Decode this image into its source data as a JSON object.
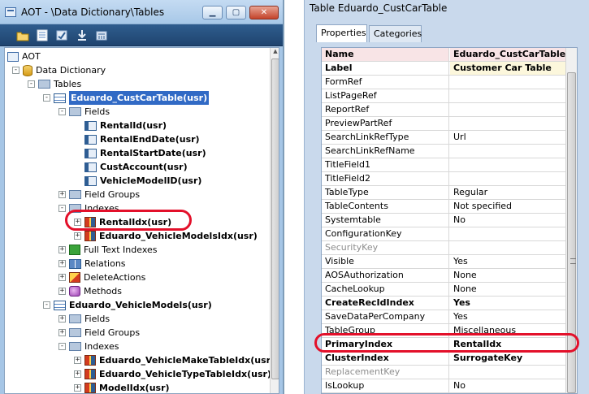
{
  "aot_window": {
    "title": "AOT - \\Data Dictionary\\Tables",
    "controls": {
      "minimize": "▁",
      "maximize": "▢",
      "close": "✕"
    },
    "toolbar": [
      "open-folder-icon",
      "properties-icon",
      "compile-icon",
      "import-icon",
      "calculator-icon"
    ],
    "tree": [
      {
        "label": "AOT",
        "icon": "aot-icon",
        "expander": "-"
      },
      {
        "label": "Data Dictionary",
        "icon": "database-icon",
        "expander": "-"
      },
      {
        "label": "Tables",
        "icon": "folder-icon",
        "expander": "-"
      },
      {
        "label": "Eduardo_CustCarTable(usr)",
        "icon": "table-icon",
        "expander": "-",
        "bold": true,
        "selected": true
      },
      {
        "label": "Fields",
        "icon": "folder-icon",
        "expander": "-"
      },
      {
        "label": "RentalId(usr)",
        "icon": "field-icon",
        "bold": true
      },
      {
        "label": "RentalEndDate(usr)",
        "icon": "field-icon",
        "bold": true
      },
      {
        "label": "RentalStartDate(usr)",
        "icon": "field-icon",
        "bold": true
      },
      {
        "label": "CustAccount(usr)",
        "icon": "field-icon",
        "bold": true
      },
      {
        "label": "VehicleModelID(usr)",
        "icon": "field-icon",
        "bold": true
      },
      {
        "label": "Field Groups",
        "icon": "field-groups-icon",
        "expander": "+"
      },
      {
        "label": "Indexes",
        "icon": "folder-icon",
        "expander": "-"
      },
      {
        "label": "RentalIdx(usr)",
        "icon": "index-icon",
        "expander": "+",
        "bold": true
      },
      {
        "label": "Eduardo_VehicleModelsIdx(usr)",
        "icon": "index-icon",
        "expander": "+",
        "bold": true
      },
      {
        "label": "Full Text Indexes",
        "icon": "full-text-index-icon",
        "expander": "+"
      },
      {
        "label": "Relations",
        "icon": "relations-icon",
        "expander": "+"
      },
      {
        "label": "DeleteActions",
        "icon": "delete-actions-icon",
        "expander": "+"
      },
      {
        "label": "Methods",
        "icon": "methods-icon",
        "expander": "+"
      },
      {
        "label": "Eduardo_VehicleModels(usr)",
        "icon": "table-icon",
        "expander": "-",
        "bold": true
      },
      {
        "label": "Fields",
        "icon": "folder-icon",
        "expander": "+"
      },
      {
        "label": "Field Groups",
        "icon": "field-groups-icon",
        "expander": "+"
      },
      {
        "label": "Indexes",
        "icon": "folder-icon",
        "expander": "-"
      },
      {
        "label": "Eduardo_VehicleMakeTableIdx(usr)",
        "icon": "index-icon",
        "expander": "+",
        "bold": true
      },
      {
        "label": "Eduardo_VehicleTypeTableIdx(usr)",
        "icon": "index-icon",
        "expander": "+",
        "bold": true
      },
      {
        "label": "ModelIdx(usr)",
        "icon": "index-icon",
        "expander": "+",
        "bold": true
      }
    ]
  },
  "props_window": {
    "title": "Table Eduardo_CustCarTable",
    "tabs": [
      "Properties",
      "Categories"
    ],
    "rows": [
      {
        "name": "Name",
        "value": "Eduardo_CustCarTable",
        "style": "head"
      },
      {
        "name": "Label",
        "value": "Customer Car Table",
        "style": "label"
      },
      {
        "name": "FormRef",
        "value": ""
      },
      {
        "name": "ListPageRef",
        "value": ""
      },
      {
        "name": "ReportRef",
        "value": ""
      },
      {
        "name": "PreviewPartRef",
        "value": ""
      },
      {
        "name": "SearchLinkRefType",
        "value": "Url"
      },
      {
        "name": "SearchLinkRefName",
        "value": ""
      },
      {
        "name": "TitleField1",
        "value": ""
      },
      {
        "name": "TitleField2",
        "value": ""
      },
      {
        "name": "TableType",
        "value": "Regular"
      },
      {
        "name": "TableContents",
        "value": "Not specified"
      },
      {
        "name": "Systemtable",
        "value": "No"
      },
      {
        "name": "ConfigurationKey",
        "value": ""
      },
      {
        "name": "SecurityKey",
        "value": "",
        "style": "dim"
      },
      {
        "name": "Visible",
        "value": "Yes"
      },
      {
        "name": "AOSAuthorization",
        "value": "None"
      },
      {
        "name": "CacheLookup",
        "value": "None"
      },
      {
        "name": "CreateRecIdIndex",
        "value": "Yes",
        "style": "bold"
      },
      {
        "name": "SaveDataPerCompany",
        "value": "Yes"
      },
      {
        "name": "TableGroup",
        "value": "Miscellaneous"
      },
      {
        "name": "PrimaryIndex",
        "value": "RentalIdx",
        "style": "bold"
      },
      {
        "name": "ClusterIndex",
        "value": "SurrogateKey",
        "style": "bold"
      },
      {
        "name": "ReplacementKey",
        "value": "",
        "style": "dim"
      },
      {
        "name": "IsLookup",
        "value": "No"
      }
    ]
  },
  "colors": {
    "annotation": "#e3102a",
    "selection": "#316ac5",
    "window_frame": "#a6c6e6"
  }
}
